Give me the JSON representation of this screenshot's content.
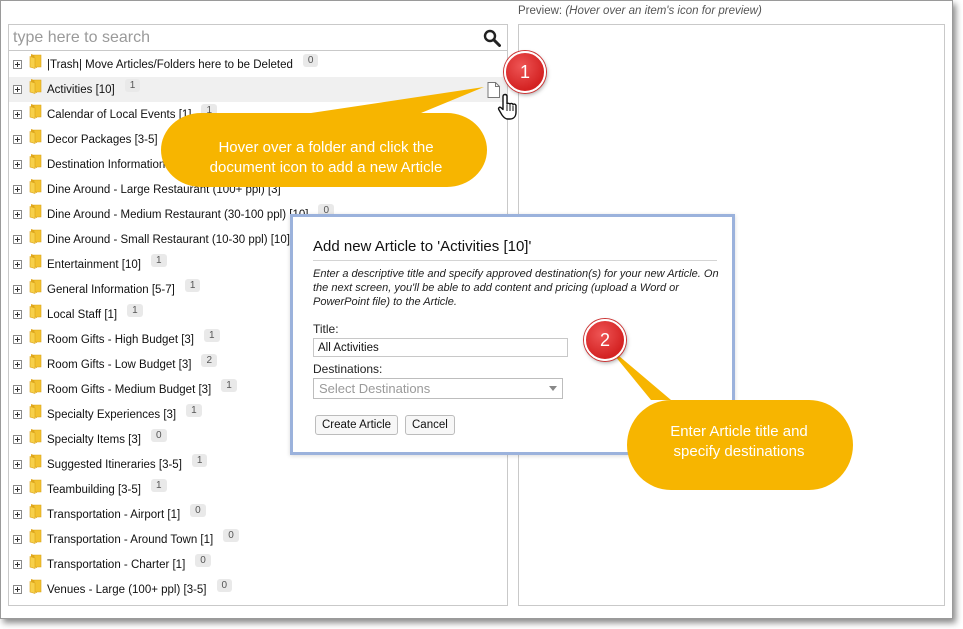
{
  "search": {
    "placeholder": "type here to search"
  },
  "preview": {
    "label": "Preview:",
    "hint": "(Hover over an item's icon for preview)"
  },
  "tree": {
    "items": [
      {
        "label": "|Trash| Move Articles/Folders here to be Deleted",
        "count": "0"
      },
      {
        "label": "Activities [10]",
        "count": "1"
      },
      {
        "label": "Calendar of Local Events [1]",
        "count": "1"
      },
      {
        "label": "Decor Packages [3-5]",
        "count": "1"
      },
      {
        "label": "Destination Information [1",
        "count": ""
      },
      {
        "label": "Dine Around - Large Restaurant (100+ ppl) [3]",
        "count": ""
      },
      {
        "label": "Dine Around - Medium Restaurant (30-100 ppl) [10]",
        "count": "0"
      },
      {
        "label": "Dine Around - Small Restaurant (10-30 ppl) [10]",
        "count": "0"
      },
      {
        "label": "Entertainment [10]",
        "count": "1"
      },
      {
        "label": "General Information [5-7]",
        "count": "1"
      },
      {
        "label": "Local Staff [1]",
        "count": "1"
      },
      {
        "label": "Room Gifts - High Budget [3]",
        "count": "1"
      },
      {
        "label": "Room Gifts - Low Budget [3]",
        "count": "2"
      },
      {
        "label": "Room Gifts - Medium Budget [3]",
        "count": "1"
      },
      {
        "label": "Specialty Experiences [3]",
        "count": "1"
      },
      {
        "label": "Specialty Items [3]",
        "count": "0"
      },
      {
        "label": "Suggested Itineraries [3-5]",
        "count": "1"
      },
      {
        "label": "Teambuilding [3-5]",
        "count": "1"
      },
      {
        "label": "Transportation - Airport [1]",
        "count": "0"
      },
      {
        "label": "Transportation - Around Town [1]",
        "count": "0"
      },
      {
        "label": "Transportation - Charter [1]",
        "count": "0"
      },
      {
        "label": "Venues - Large (100+ ppl) [3-5]",
        "count": "0"
      }
    ]
  },
  "dialog": {
    "title": "Add new Article to 'Activities [10]'",
    "description": "Enter a descriptive title and specify approved destination(s) for your new Article. On the next screen, you'll be able to add content and pricing (upload a Word or PowerPoint file) to the Article.",
    "title_label": "Title:",
    "title_value": "All Activities",
    "destinations_label": "Destinations:",
    "destinations_placeholder": "Select Destinations",
    "create_label": "Create Article",
    "cancel_label": "Cancel"
  },
  "callouts": {
    "one": {
      "number": "1",
      "text": "Hover over a folder and click the document icon to add a new Article"
    },
    "two": {
      "number": "2",
      "text": "Enter Article title and specify destinations"
    }
  },
  "colors": {
    "callout_fill": "#f7b500",
    "badge_red": "#d42222",
    "dialog_border": "#9bb2dc",
    "folder_yellow": "#f2c230"
  },
  "icons": [
    "search-icon",
    "folder-icon",
    "document-icon",
    "hand-cursor-icon",
    "chevron-down-icon",
    "expand-toggle-icon"
  ]
}
